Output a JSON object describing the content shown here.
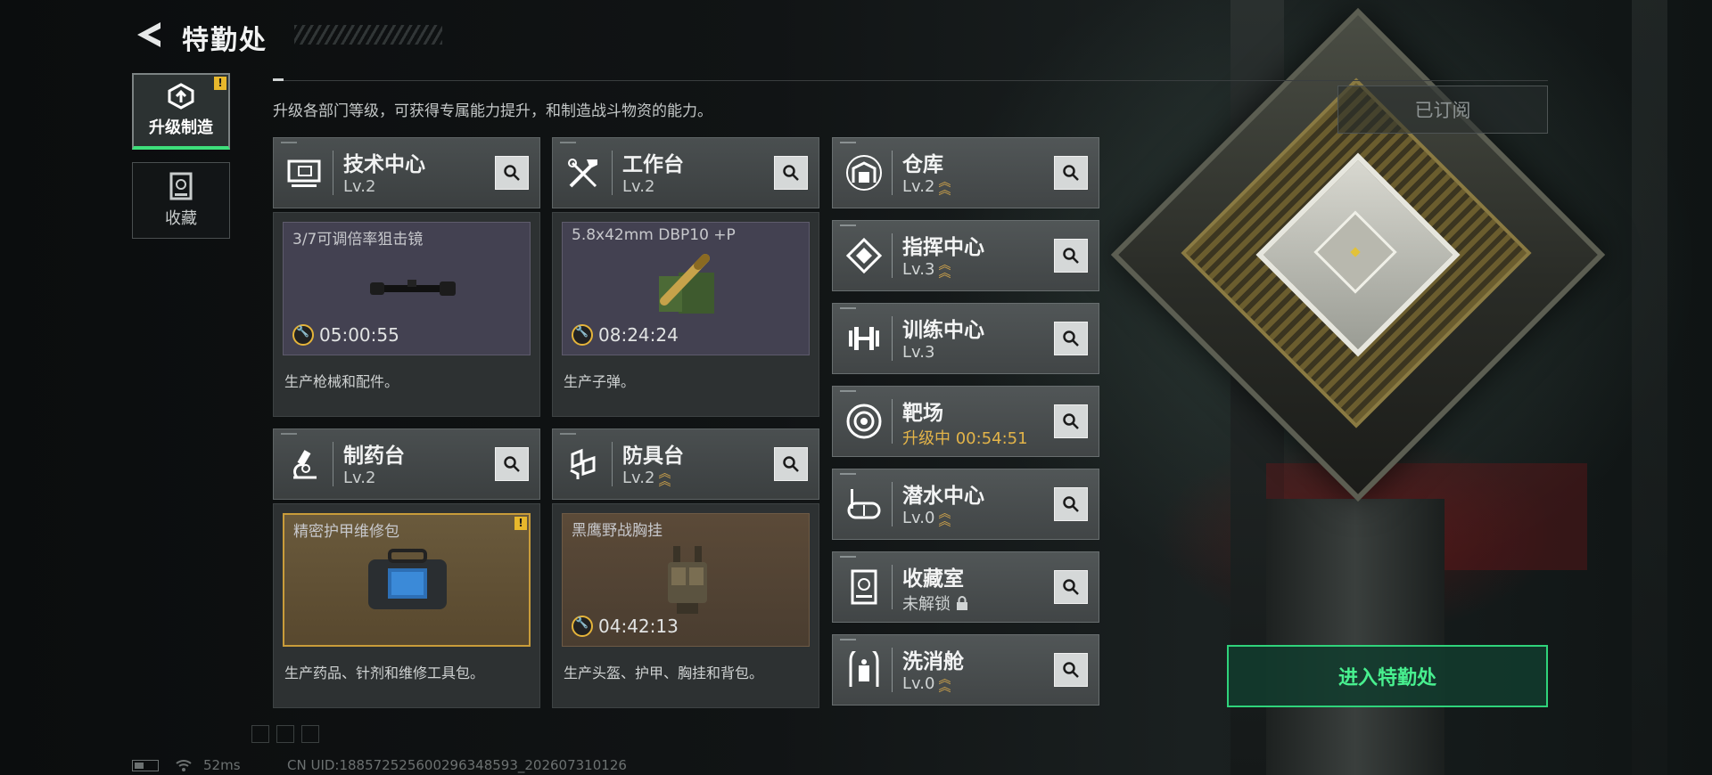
{
  "header": {
    "title": "特勤处",
    "subtitle": "升级各部门等级，可获得专属能力提升，和制造战斗物资的能力。"
  },
  "nav": {
    "items": [
      {
        "label": "升级制造",
        "icon": "upgrade-craft-icon",
        "active": true,
        "badge": "!"
      },
      {
        "label": "收藏",
        "icon": "collection-icon",
        "active": false
      }
    ]
  },
  "subscribe_label": "已订阅",
  "modules": [
    {
      "name": "技术中心",
      "level": "Lv.2",
      "icon": "monitor-icon",
      "craft_item": "3/7可调倍率狙击镜",
      "timer": "05:00:55",
      "desc": "生产枪械和配件。"
    },
    {
      "name": "工作台",
      "level": "Lv.2",
      "icon": "tools-icon",
      "craft_item": "5.8x42mm DBP10 +P",
      "timer": "08:24:24",
      "desc": "生产子弹。"
    },
    {
      "name": "制药台",
      "level": "Lv.2",
      "icon": "microscope-icon",
      "craft_item": "精密护甲维修包",
      "timer": "",
      "desc": "生产药品、针剂和维修工具包。",
      "badge": "!"
    },
    {
      "name": "防具台",
      "level": "Lv.2",
      "icon": "armor-icon",
      "craft_item": "黑鹰野战胸挂",
      "timer": "04:42:13",
      "desc": "生产头盔、护甲、胸挂和背包。"
    }
  ],
  "rooms": [
    {
      "name": "仓库",
      "level": "Lv.2",
      "icon": "warehouse-icon",
      "upgradable": true
    },
    {
      "name": "指挥中心",
      "level": "Lv.3",
      "icon": "command-icon",
      "upgradable": true
    },
    {
      "name": "训练中心",
      "level": "Lv.3",
      "icon": "dumbbell-icon",
      "upgradable": false
    },
    {
      "name": "靶场",
      "level": "升级中 00:54:51",
      "icon": "target-icon",
      "upgrading": true
    },
    {
      "name": "潜水中心",
      "level": "Lv.0",
      "icon": "diving-mask-icon",
      "upgradable": true
    },
    {
      "name": "收藏室",
      "level": "未解锁",
      "icon": "collection-room-icon",
      "locked": true
    },
    {
      "name": "洗消舱",
      "level": "Lv.0",
      "icon": "decon-icon",
      "upgradable": true
    }
  ],
  "enter_button": "进入特勤处",
  "status": {
    "ping": "52ms",
    "uid": "CN UID:188572525600296348593_202607310126"
  },
  "colors": {
    "accent_green": "#2fd37b",
    "upgrade_gold": "#d8a94a",
    "warning_yellow": "#e8b82c"
  }
}
